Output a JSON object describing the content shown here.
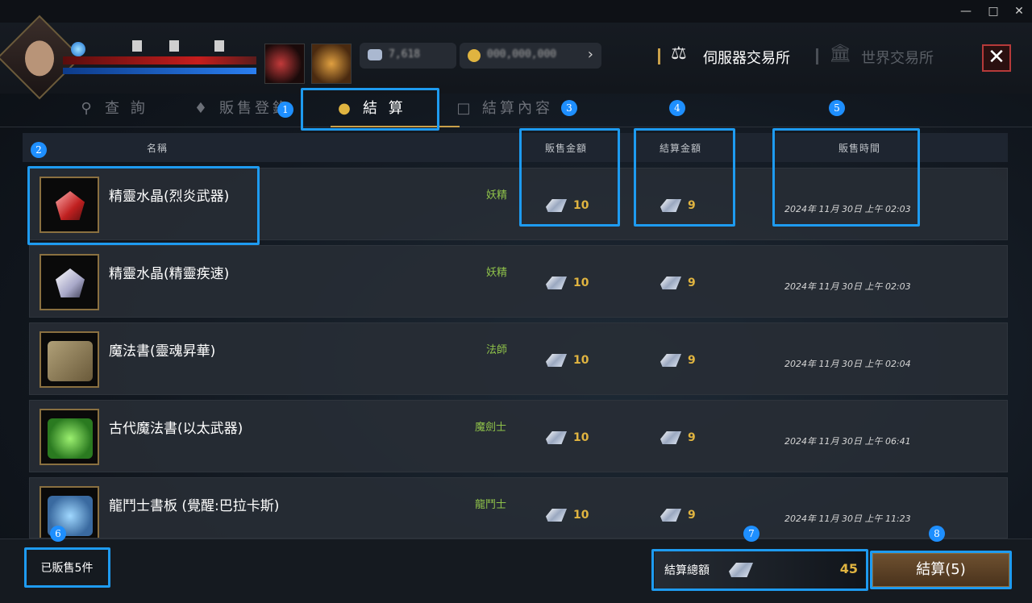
{
  "window": {
    "min_icon": "minimize-icon",
    "max_icon": "maximize-icon",
    "close_icon": "close-icon"
  },
  "header": {
    "market_server": "伺服器交易所",
    "market_world": "世界交易所",
    "close_icon": "close-x-icon"
  },
  "tabs": [
    {
      "label": "查 詢",
      "icon": "search-icon"
    },
    {
      "label": "販售登錄",
      "icon": "tag-icon"
    },
    {
      "label": "結 算",
      "icon": "coins-icon",
      "active": true
    },
    {
      "label": "結算內容",
      "icon": "cards-icon"
    }
  ],
  "table": {
    "col_name": "名稱",
    "col_sale": "販售金額",
    "col_settle": "結算金額",
    "col_time": "販售時間"
  },
  "rows": [
    {
      "name": "精靈水晶(烈炎武器)",
      "class": "妖精",
      "sale": "10",
      "settle": "9",
      "time": "2024年 11月 30日 上午 02:03",
      "icon": "red-crystal-icon"
    },
    {
      "name": "精靈水晶(精靈疾速)",
      "class": "妖精",
      "sale": "10",
      "settle": "9",
      "time": "2024年 11月 30日 上午 02:03",
      "icon": "white-crystal-icon"
    },
    {
      "name": "魔法書(靈魂昇華)",
      "class": "法師",
      "sale": "10",
      "settle": "9",
      "time": "2024年 11月 30日 上午 02:04",
      "icon": "spellbook-icon"
    },
    {
      "name": "古代魔法書(以太武器)",
      "class": "魔劍士",
      "sale": "10",
      "settle": "9",
      "time": "2024年 11月 30日 上午 06:41",
      "icon": "ancient-spellbook-icon"
    },
    {
      "name": "龍鬥士書板 (覺醒:巴拉卡斯)",
      "class": "龍鬥士",
      "sale": "10",
      "settle": "9",
      "time": "2024年 11月 30日 上午 11:23",
      "icon": "dragon-tablet-icon"
    }
  ],
  "footer": {
    "sold_count": "已販售5件",
    "total_label": "結算總額",
    "total_value": "45",
    "settle_button": "結算(5)"
  },
  "annotations": [
    "1",
    "2",
    "3",
    "4",
    "5",
    "6",
    "7",
    "8"
  ],
  "colors": {
    "accent_blue": "#1e9bf0",
    "gold": "#e0b440",
    "class_green": "#8fc24a"
  }
}
